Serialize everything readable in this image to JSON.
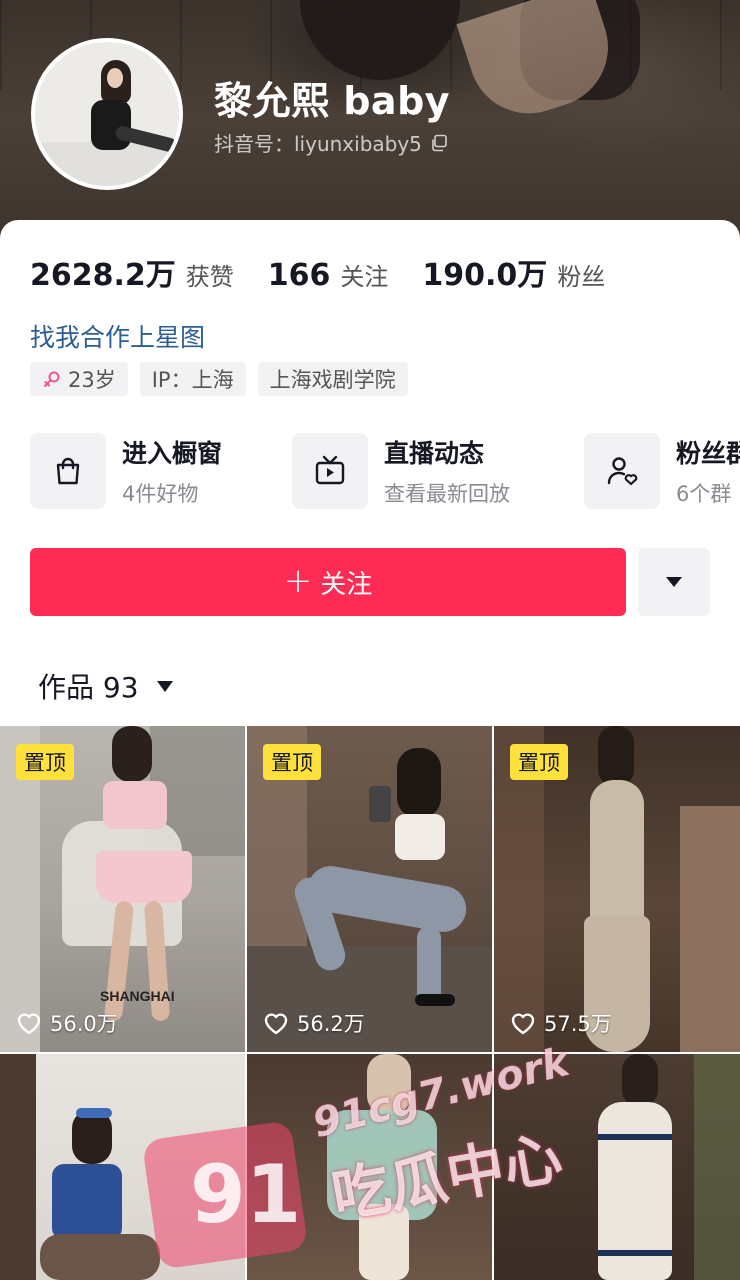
{
  "profile": {
    "name": "黎允熙 baby",
    "handle": "抖音号：liyunxibaby5"
  },
  "stats": [
    {
      "value": "2628.2万",
      "label": "获赞"
    },
    {
      "value": "166",
      "label": "关注"
    },
    {
      "value": "190.0万",
      "label": "粉丝"
    }
  ],
  "collab_link": "找我合作上星图",
  "tags": {
    "age": "23岁",
    "ip": "IP：上海",
    "school": "上海戏剧学院"
  },
  "services": [
    {
      "title": "进入橱窗",
      "subtitle": "4件好物",
      "icon": "shopping-bag-icon"
    },
    {
      "title": "直播动态",
      "subtitle": "查看最新回放",
      "icon": "tv-icon"
    },
    {
      "title": "粉丝群",
      "subtitle": "6个群",
      "icon": "fan-group-icon"
    }
  ],
  "actions": {
    "follow_label": "关注",
    "follow_color": "#fe2c55"
  },
  "works_tab": {
    "label": "作品 93"
  },
  "videos": [
    {
      "pinned": "置顶",
      "likes": "56.0万",
      "overlay_text": "SHANGHAI"
    },
    {
      "pinned": "置顶",
      "likes": "56.2万"
    },
    {
      "pinned": "置顶",
      "likes": "57.5万"
    },
    {},
    {},
    {}
  ],
  "watermark": {
    "badge": "91",
    "url": "91cg7.work",
    "text": "吃瓜中心"
  },
  "colors": {
    "accent": "#fe2c55",
    "link": "#2d5e93",
    "pin_badge": "#ffe13d"
  }
}
